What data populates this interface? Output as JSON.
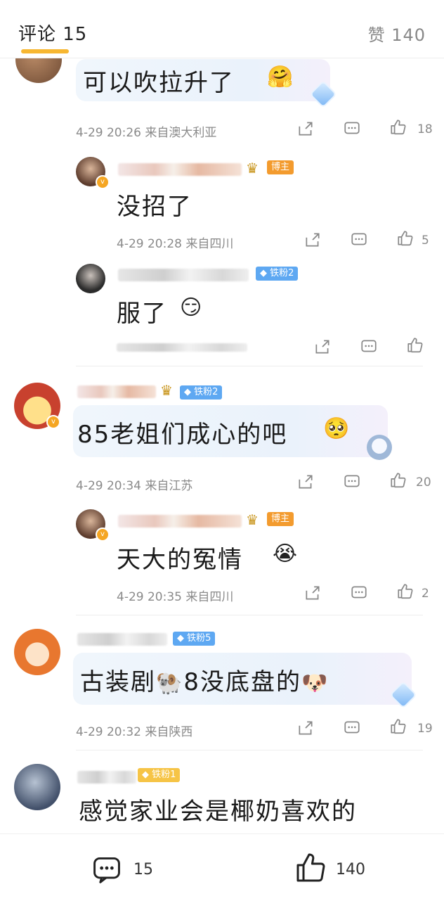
{
  "header": {
    "comments_tab_label": "评论 15",
    "likes_summary": "赞 140"
  },
  "comments": [
    {
      "text": "可以吹拉升了",
      "time": "4-29 20:26",
      "location": "来自澳大利亚",
      "likes": "18"
    },
    {
      "tag": "博主",
      "text": "没招了",
      "time": "4-29 20:28",
      "location": "来自四川",
      "likes": "5"
    },
    {
      "tag": "铁粉2",
      "text": "服了"
    },
    {
      "tag": "铁粉2",
      "text": "85老姐们成心的吧",
      "time": "4-29 20:34",
      "location": "来自江苏",
      "likes": "20"
    },
    {
      "tag": "博主",
      "text": "天大的冤情",
      "time": "4-29 20:35",
      "location": "来自四川",
      "likes": "2"
    },
    {
      "tag": "铁粉5",
      "text": "古装剧",
      "text2": "8没底盘的",
      "time": "4-29 20:32",
      "location": "来自陕西",
      "likes": "19"
    },
    {
      "tag": "铁粉1",
      "text": "感觉家业会是椰奶喜欢的"
    }
  ],
  "bottom_bar": {
    "comment_count": "15",
    "like_count": "140"
  },
  "colors": {
    "accent_underline": "#f7b731",
    "blogger_tag": "#f39b2e",
    "fan_tag": "#5ea8f2"
  },
  "icons": [
    "share-icon",
    "reply-icon",
    "like-icon",
    "crown-icon",
    "verified-badge-icon",
    "diamond-icon"
  ]
}
